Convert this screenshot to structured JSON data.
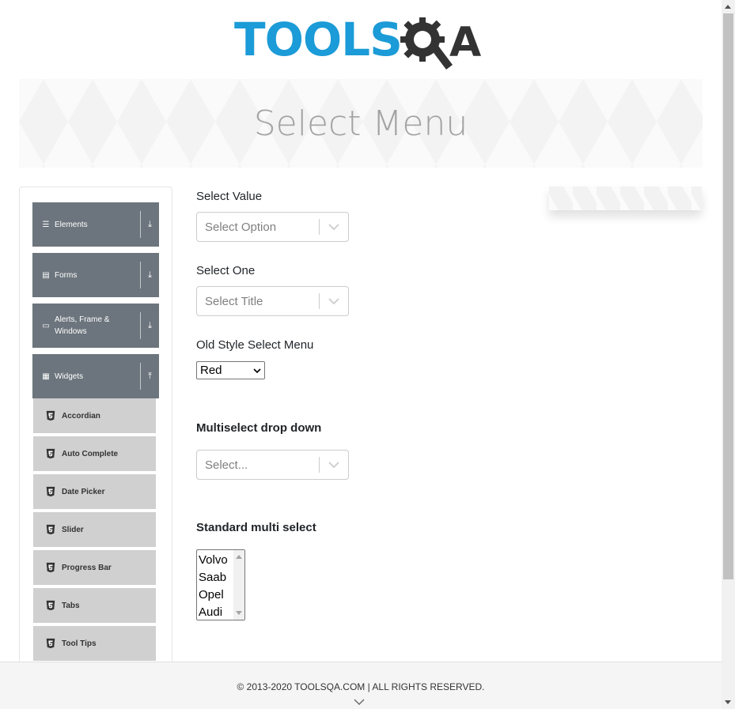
{
  "logo": {
    "part1": "TOOLS",
    "part2": "A"
  },
  "page_title": "Select Menu",
  "sidebar": {
    "groups": [
      {
        "label": "Elements",
        "icon": "menu-icon",
        "arrow": "download-icon"
      },
      {
        "label": "Forms",
        "icon": "form-icon",
        "arrow": "download-icon"
      },
      {
        "label": "Alerts, Frame & Windows",
        "icon": "window-icon",
        "arrow": "download-icon"
      },
      {
        "label": "Widgets",
        "icon": "grid-icon",
        "arrow": "upload-icon"
      }
    ],
    "items": [
      {
        "label": "Accordian"
      },
      {
        "label": "Auto Complete"
      },
      {
        "label": "Date Picker"
      },
      {
        "label": "Slider"
      },
      {
        "label": "Progress Bar"
      },
      {
        "label": "Tabs"
      },
      {
        "label": "Tool Tips"
      }
    ]
  },
  "form": {
    "select_value_label": "Select Value",
    "select_value_placeholder": "Select Option",
    "select_one_label": "Select One",
    "select_one_placeholder": "Select Title",
    "old_style_label": "Old Style Select Menu",
    "old_style_value": "Red",
    "multiselect_label": "Multiselect drop down",
    "multiselect_placeholder": "Select...",
    "standard_multi_label": "Standard multi select",
    "standard_multi_options": [
      "Volvo",
      "Saab",
      "Opel",
      "Audi"
    ]
  },
  "footer": {
    "copyright": "© 2013-2020 TOOLSQA.COM | ALL RIGHTS RESERVED."
  },
  "colors": {
    "brand_blue": "#1b9bd7",
    "sidebar_group": "#6c757d",
    "sidebar_item": "#d0d0d0"
  }
}
